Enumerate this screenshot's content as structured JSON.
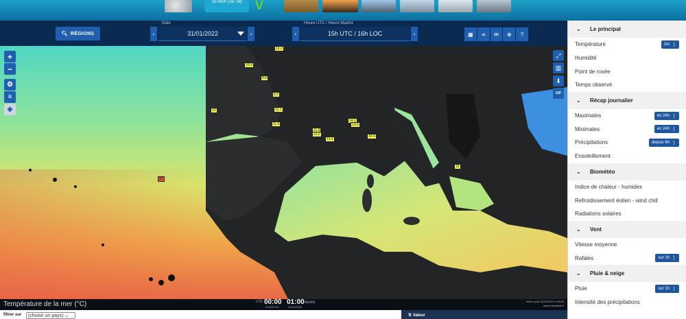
{
  "top_strip": {
    "wind_badge": "32 km/h (raf. 58)",
    "v_logo": "V"
  },
  "toolbar": {
    "regions_label": "RÉGIONS",
    "date_label": "Date",
    "date_value": "31/01/2022",
    "hour_label": "Heure UTC / Heure Madrid",
    "hour_value": "15h UTC / 16h LOC",
    "prev_arrow": "‹",
    "next_arrow": "›",
    "icons": [
      "calendar-icon",
      "share-icon",
      "message-icon",
      "globe-icon",
      "help-icon"
    ]
  },
  "map": {
    "controls_left": [
      "+",
      "−"
    ],
    "controls_right": [
      "fullscreen-icon",
      "building-icon",
      "download-icon",
      "GIF"
    ],
    "gif_label": "GIF",
    "labels": [
      {
        "text": "13.3",
        "kind": "normal"
      },
      {
        "text": "10.9",
        "kind": "normal"
      },
      {
        "text": "8.8",
        "kind": "normal"
      },
      {
        "text": "9.2",
        "kind": "normal"
      },
      {
        "text": "13",
        "kind": "normal"
      },
      {
        "text": "12.1",
        "kind": "normal"
      },
      {
        "text": "11.6",
        "kind": "normal"
      },
      {
        "text": "11.8",
        "kind": "normal"
      },
      {
        "text": "13.2",
        "kind": "normal"
      },
      {
        "text": "13.4",
        "kind": "normal"
      },
      {
        "text": "14.2",
        "kind": "normal"
      },
      {
        "text": "13.6",
        "kind": "normal"
      },
      {
        "text": "14.4",
        "kind": "normal"
      },
      {
        "text": "15",
        "kind": "normal"
      },
      {
        "text": "21",
        "kind": "red"
      }
    ]
  },
  "footer": {
    "legend_title": "Température de la mer (°C)",
    "utc_label": "UTC",
    "utc_time": "00:00",
    "utc_date": "01/02/2022",
    "loc_time": "01:00",
    "loc_label": "Madrid",
    "loc_date": "01/02/2022",
    "update_line1": "mise à jour 31/01/2022 à 18:05",
    "update_line2": "www.infoclimat.fr"
  },
  "bottom": {
    "filter_label": "filtrer sur",
    "country_select": "(choisir un pays)",
    "value_header": "Valeur"
  },
  "panel": {
    "sections": [
      {
        "title": "Le principal",
        "items": [
          {
            "label": "Température",
            "pill": "2m"
          },
          {
            "label": "Humidité",
            "pill": ""
          },
          {
            "label": "Point de rosée",
            "pill": ""
          },
          {
            "label": "Temps observé",
            "pill": ""
          }
        ]
      },
      {
        "title": "Récap journalier",
        "items": [
          {
            "label": "Maximales",
            "pill": "en 24h"
          },
          {
            "label": "Minimales",
            "pill": "en 24h"
          },
          {
            "label": "Précipitations",
            "pill": "depuis 6h"
          },
          {
            "label": "Ensoleillement",
            "pill": ""
          }
        ]
      },
      {
        "title": "Biométéo",
        "items": [
          {
            "label": "Indice de chaleur - humidex",
            "pill": ""
          },
          {
            "label": "Refroidissement éolien - wind chill",
            "pill": ""
          },
          {
            "label": "Radiations solaires",
            "pill": ""
          }
        ]
      },
      {
        "title": "Vent",
        "items": [
          {
            "label": "Vitesse moyenne",
            "pill": ""
          },
          {
            "label": "Rafales",
            "pill": "sur 1h"
          }
        ]
      },
      {
        "title": "Pluie & neige",
        "items": [
          {
            "label": "Pluie",
            "pill": "sur 1h"
          },
          {
            "label": "Intensité des précipitations",
            "pill": ""
          }
        ]
      }
    ]
  }
}
